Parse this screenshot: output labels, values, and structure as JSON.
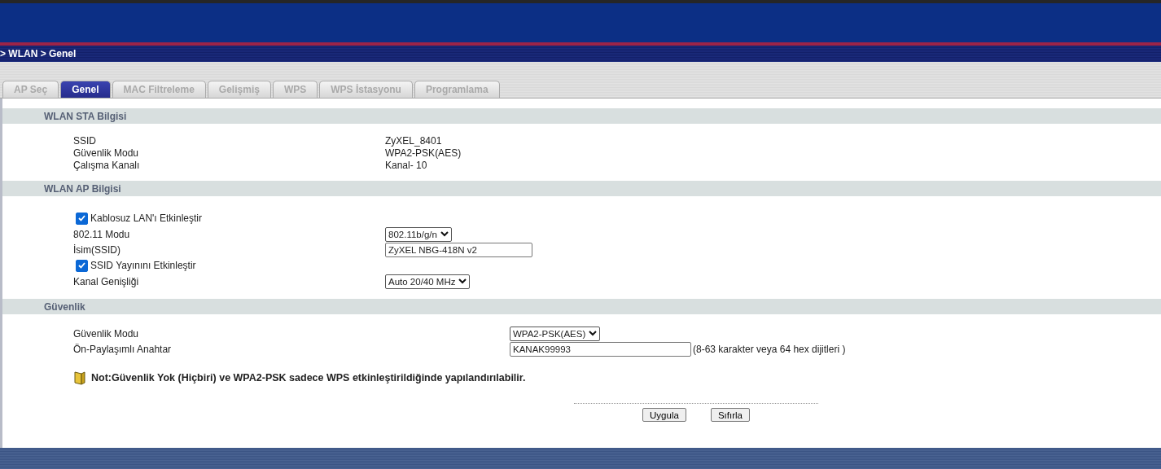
{
  "breadcrumb": "> WLAN > Genel",
  "tabs": [
    {
      "label": "AP Seç",
      "selected": false
    },
    {
      "label": "Genel",
      "selected": true
    },
    {
      "label": "MAC Filtreleme",
      "selected": false
    },
    {
      "label": "Gelişmiş",
      "selected": false
    },
    {
      "label": "WPS",
      "selected": false
    },
    {
      "label": "WPS İstasyonu",
      "selected": false
    },
    {
      "label": "Programlama",
      "selected": false
    }
  ],
  "sections": [
    {
      "title": "WLAN STA Bilgisi",
      "kind": "info",
      "rows": [
        {
          "kind": "text",
          "label": "SSID",
          "value": "ZyXEL_8401"
        },
        {
          "kind": "text",
          "label": "Güvenlik Modu",
          "value": "WPA2-PSK(AES)"
        },
        {
          "kind": "text",
          "label": "Çalışma Kanalı",
          "value": "Kanal- 10"
        }
      ]
    },
    {
      "title": "WLAN AP Bilgisi",
      "kind": "form",
      "rows": [
        {
          "kind": "checkbox",
          "label": "Kablosuz LAN'ı Etkinleştir",
          "checked": true
        },
        {
          "kind": "select",
          "label": "802.11 Modu",
          "value": "802.11b/g/n"
        },
        {
          "kind": "input",
          "label": "İsim(SSID)",
          "value": "ZyXEL NBG-418N v2"
        },
        {
          "kind": "checkbox",
          "label": "SSID Yayınını Etkinleştir",
          "checked": true
        },
        {
          "kind": "select",
          "label": "Kanal Genişliği",
          "value": "Auto 20/40 MHz"
        }
      ]
    },
    {
      "title": "Güvenlik",
      "kind": "security",
      "rows": [
        {
          "kind": "select",
          "label": "Güvenlik Modu",
          "value": "WPA2-PSK(AES)"
        },
        {
          "kind": "input",
          "label": "Ön-Paylaşımlı Anahtar",
          "value": "KANAK99993",
          "hint": "(8-63 karakter veya 64 hex dijitleri )"
        }
      ],
      "note": "Not:Güvenlik Yok (Hiçbiri) ve WPA2-PSK sadece WPS etkinleştirildiğinde yapılandırılabilir."
    }
  ],
  "buttons": [
    "Uygula",
    "Sıfırla"
  ]
}
